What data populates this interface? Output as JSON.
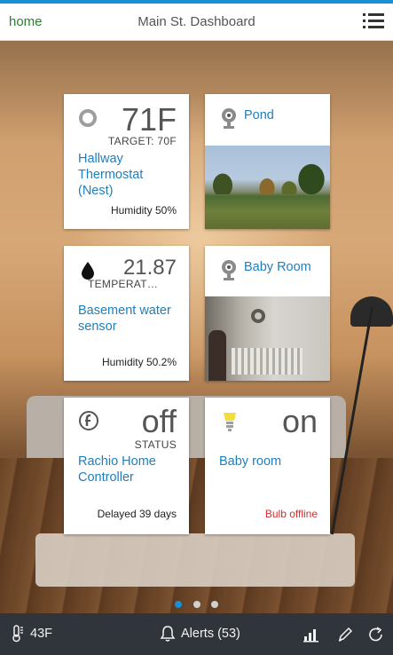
{
  "header": {
    "home_label": "home",
    "title": "Main St. Dashboard",
    "menu_icon": "list-menu-icon"
  },
  "tiles": {
    "thermostat": {
      "icon": "thermostat-ring-icon",
      "value": "71F",
      "sub": "TARGET: 70F",
      "name": "Hallway Thermostat (Nest)",
      "footer": "Humidity 50%"
    },
    "pond": {
      "icon": "camera-icon",
      "name": "Pond"
    },
    "water_sensor": {
      "icon": "water-drop-icon",
      "value": "21.87",
      "sub": "TEMPERAT…",
      "name": "Basement water sensor",
      "footer": "Humidity 50.2%"
    },
    "baby_cam": {
      "icon": "camera-icon",
      "name": "Baby Room"
    },
    "rachio": {
      "icon": "rachio-icon",
      "value": "off",
      "sub": "STATUS",
      "name": "Rachio Home Controller",
      "footer": "Delayed 39 days"
    },
    "bulb": {
      "icon": "light-bulb-icon",
      "value": "on",
      "name": "Baby room",
      "footer": "Bulb offline",
      "footer_color": "#d32f2f"
    }
  },
  "pager": {
    "pages": 3,
    "active_index": 0
  },
  "bottom": {
    "weather": "43F",
    "alerts": "Alerts (53)"
  },
  "colors": {
    "accent": "#1a8fd6",
    "link": "#1f7fbd",
    "home": "#2e7d32",
    "bottom_bar": "#30353b"
  }
}
